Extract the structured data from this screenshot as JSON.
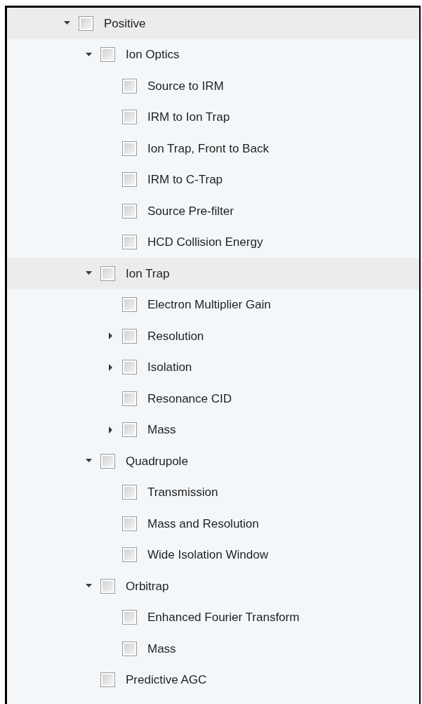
{
  "tree": [
    {
      "label": "Positive",
      "checked": false,
      "expanded": true,
      "highlighted": true,
      "children": [
        {
          "label": "Ion Optics",
          "checked": false,
          "expanded": true,
          "highlighted": false,
          "children": [
            {
              "label": "Source to IRM",
              "checked": false,
              "highlighted": false
            },
            {
              "label": "IRM to Ion Trap",
              "checked": false,
              "highlighted": false
            },
            {
              "label": "Ion Trap, Front to Back",
              "checked": false,
              "highlighted": false
            },
            {
              "label": "IRM to C-Trap",
              "checked": false,
              "highlighted": false
            },
            {
              "label": "Source Pre-filter",
              "checked": false,
              "highlighted": false
            },
            {
              "label": "HCD Collision Energy",
              "checked": false,
              "highlighted": false
            }
          ]
        },
        {
          "label": "Ion Trap",
          "checked": false,
          "expanded": true,
          "highlighted": true,
          "children": [
            {
              "label": "Electron Multiplier Gain",
              "checked": false,
              "highlighted": false
            },
            {
              "label": "Resolution",
              "checked": false,
              "expanded": false,
              "highlighted": false
            },
            {
              "label": "Isolation",
              "checked": false,
              "expanded": false,
              "highlighted": false
            },
            {
              "label": "Resonance CID",
              "checked": false,
              "highlighted": false
            },
            {
              "label": "Mass",
              "checked": false,
              "expanded": false,
              "highlighted": false
            }
          ]
        },
        {
          "label": "Quadrupole",
          "checked": false,
          "expanded": true,
          "highlighted": false,
          "children": [
            {
              "label": "Transmission",
              "checked": false,
              "highlighted": false
            },
            {
              "label": "Mass and Resolution",
              "checked": false,
              "highlighted": false
            },
            {
              "label": "Wide Isolation Window",
              "checked": false,
              "highlighted": false
            }
          ]
        },
        {
          "label": "Orbitrap",
          "checked": false,
          "expanded": true,
          "highlighted": false,
          "children": [
            {
              "label": "Enhanced Fourier Transform",
              "checked": false,
              "highlighted": false
            },
            {
              "label": "Mass",
              "checked": false,
              "highlighted": false
            }
          ]
        },
        {
          "label": "Predictive AGC",
          "checked": false,
          "highlighted": false
        }
      ]
    }
  ]
}
